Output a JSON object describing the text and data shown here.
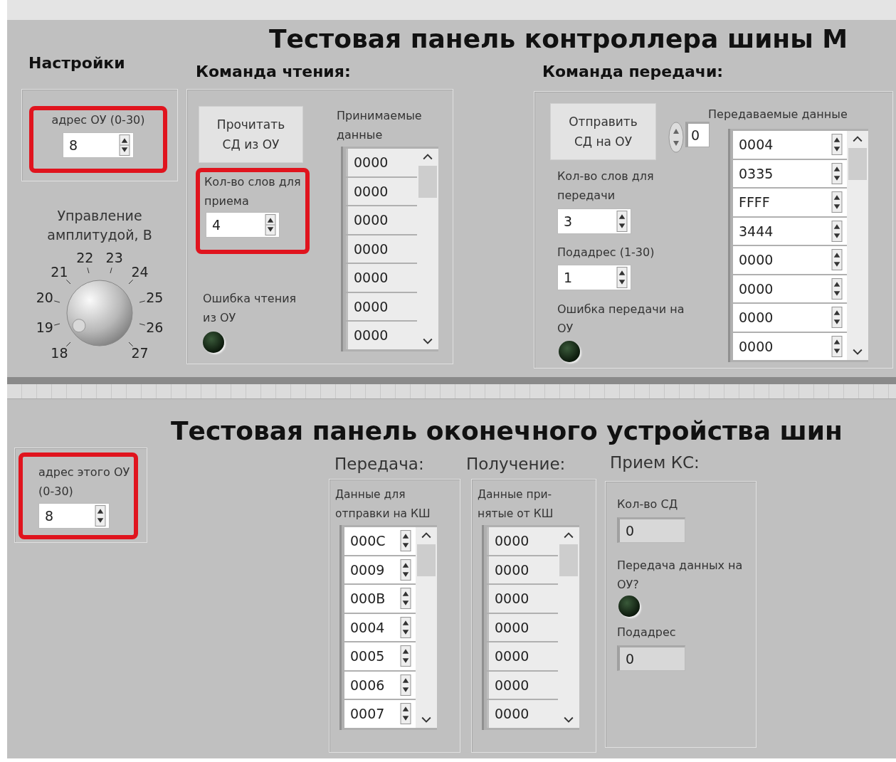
{
  "controller_panel": {
    "title": "Тестовая панель контроллера шины  М",
    "settings": {
      "heading": "Настройки",
      "address": {
        "label": "адрес ОУ (0-30)",
        "value": "8",
        "kind": "control",
        "highlighted": true
      },
      "knob": {
        "label": "Управление амплитудой, В",
        "scale": [
          "18",
          "19",
          "20",
          "21",
          "22",
          "23",
          "24",
          "25",
          "26",
          "27"
        ],
        "level": 0.05
      }
    },
    "read_command": {
      "heading": "Команда чтения:",
      "button": "Прочитать СД из ОУ",
      "word_count": {
        "label": "Кол-во слов для приема",
        "value": "4",
        "kind": "control",
        "highlighted": true
      },
      "error": {
        "label": "Ошибка чтения из ОУ",
        "on": false
      },
      "received": {
        "label": "Принимаемые данные",
        "kind": "indicator",
        "values": [
          "0000",
          "0000",
          "0000",
          "0000",
          "0000",
          "0000",
          "0000"
        ]
      }
    },
    "transmit_command": {
      "heading": "Команда передачи:",
      "button": "Отправить СД на ОУ",
      "index": "0",
      "word_count": {
        "label": "Кол-во слов для передачи",
        "value": "3",
        "kind": "control",
        "highlighted": false
      },
      "subaddress": {
        "label": "Подадрес (1-30)",
        "value": "1",
        "kind": "control",
        "highlighted": false
      },
      "error": {
        "label": "Ошибка передачи на ОУ",
        "on": false
      },
      "sent": {
        "label": "Передаваемые данные",
        "kind": "control",
        "values": [
          "0004",
          "0335",
          "FFFF",
          "3444",
          "0000",
          "0000",
          "0000",
          "0000"
        ]
      }
    }
  },
  "terminal_panel": {
    "title": "Тестовая панель оконечного устройства шин",
    "address": {
      "label": "адрес этого ОУ (0-30)",
      "value": "8",
      "kind": "control",
      "highlighted": true
    },
    "transmit": {
      "heading": "Передача:",
      "data": {
        "label": "Данные для отправки на КШ",
        "kind": "control",
        "values": [
          "000C",
          "0009",
          "000B",
          "0004",
          "0005",
          "0006",
          "0007"
        ]
      }
    },
    "receive": {
      "heading": "Получение:",
      "data": {
        "label": "Данные при-\nнятые от КШ",
        "kind": "indicator",
        "values": [
          "0000",
          "0000",
          "0000",
          "0000",
          "0000",
          "0000",
          "0000"
        ]
      }
    },
    "command_word": {
      "heading": "Прием КС:",
      "count": {
        "label": "Кол-во СД",
        "value": "0",
        "kind": "indicator"
      },
      "transfer": {
        "label": "Передача данных на ОУ?",
        "on": false
      },
      "subaddress": {
        "label": "Подадрес",
        "value": "0",
        "kind": "indicator"
      }
    }
  }
}
